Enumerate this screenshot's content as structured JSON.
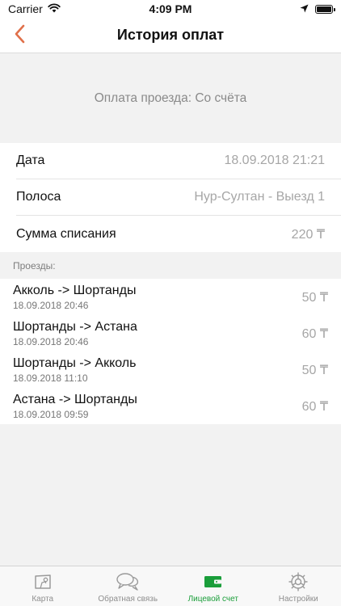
{
  "status_bar": {
    "carrier": "Carrier",
    "time": "4:09 PM"
  },
  "nav": {
    "title": "История оплат",
    "accent_color": "#e0704a"
  },
  "header": {
    "text": "Оплата проезда: Со счёта"
  },
  "details": [
    {
      "label": "Дата",
      "value": "18.09.2018 21:21"
    },
    {
      "label": "Полоса",
      "value": "Нур-Султан - Выезд 1"
    },
    {
      "label": "Сумма списания",
      "value": "220 ₸"
    }
  ],
  "trips_section": {
    "title": "Проезды:"
  },
  "trips": [
    {
      "route": "Акколь -> Шортанды",
      "date": "18.09.2018 20:46",
      "amount": "50 ₸"
    },
    {
      "route": "Шортанды -> Астана",
      "date": "18.09.2018 20:46",
      "amount": "60 ₸"
    },
    {
      "route": "Шортанды -> Акколь",
      "date": "18.09.2018 11:10",
      "amount": "50 ₸"
    },
    {
      "route": "Астана -> Шортанды",
      "date": "18.09.2018 09:59",
      "amount": "60 ₸"
    }
  ],
  "tabs": [
    {
      "label": "Карта",
      "icon": "map-icon",
      "active": false
    },
    {
      "label": "Обратная связь",
      "icon": "chat-bubbles-icon",
      "active": false
    },
    {
      "label": "Лицевой счет",
      "icon": "wallet-icon",
      "active": true
    },
    {
      "label": "Настройки",
      "icon": "gear-icon",
      "active": false
    }
  ],
  "colors": {
    "active_tab": "#1a9e3a",
    "inactive_tab": "#8e8e8e"
  }
}
